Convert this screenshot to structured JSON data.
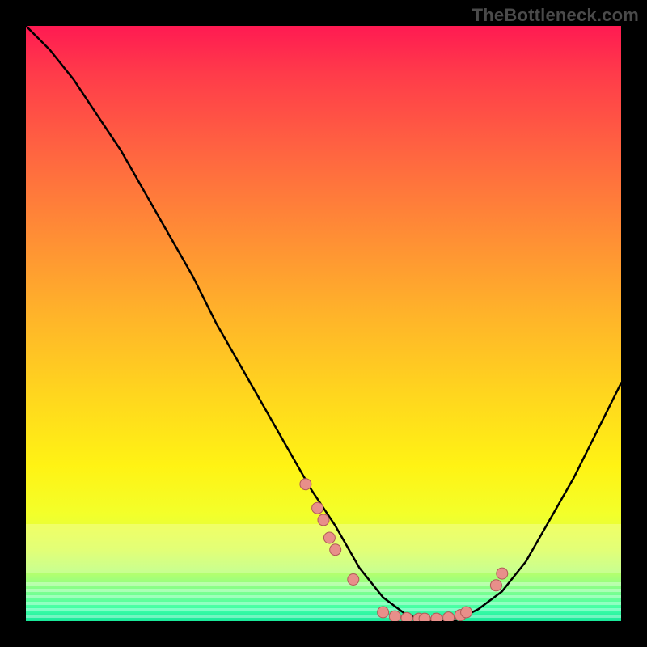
{
  "watermark": "TheBottleneck.com",
  "colors": {
    "curve_stroke": "#000000",
    "marker_fill": "#e88f8a",
    "marker_stroke": "#b05a57"
  },
  "chart_data": {
    "type": "line",
    "title": "",
    "xlabel": "",
    "ylabel": "",
    "xlim": [
      0,
      100
    ],
    "ylim": [
      0,
      100
    ],
    "grid": false,
    "legend": false,
    "background_gradient": [
      "#ff1a52",
      "#ffd61e",
      "#18e89a"
    ],
    "series": [
      {
        "name": "bottleneck-curve",
        "x": [
          0,
          4,
          8,
          12,
          16,
          20,
          24,
          28,
          32,
          36,
          40,
          44,
          48,
          52,
          56,
          60,
          64,
          68,
          72,
          76,
          80,
          84,
          88,
          92,
          96,
          100
        ],
        "y": [
          100,
          96,
          91,
          85,
          79,
          72,
          65,
          58,
          50,
          43,
          36,
          29,
          22,
          16,
          9,
          4,
          1,
          0,
          0,
          2,
          5,
          10,
          17,
          24,
          32,
          40
        ]
      }
    ],
    "markers": [
      {
        "x": 47,
        "y": 23
      },
      {
        "x": 49,
        "y": 19
      },
      {
        "x": 50,
        "y": 17
      },
      {
        "x": 51,
        "y": 14
      },
      {
        "x": 52,
        "y": 12
      },
      {
        "x": 55,
        "y": 7
      },
      {
        "x": 60,
        "y": 1.5
      },
      {
        "x": 62,
        "y": 0.8
      },
      {
        "x": 64,
        "y": 0.5
      },
      {
        "x": 66,
        "y": 0.4
      },
      {
        "x": 67,
        "y": 0.4
      },
      {
        "x": 69,
        "y": 0.4
      },
      {
        "x": 71,
        "y": 0.6
      },
      {
        "x": 73,
        "y": 1.0
      },
      {
        "x": 74,
        "y": 1.5
      },
      {
        "x": 79,
        "y": 6
      },
      {
        "x": 80,
        "y": 8
      }
    ]
  }
}
